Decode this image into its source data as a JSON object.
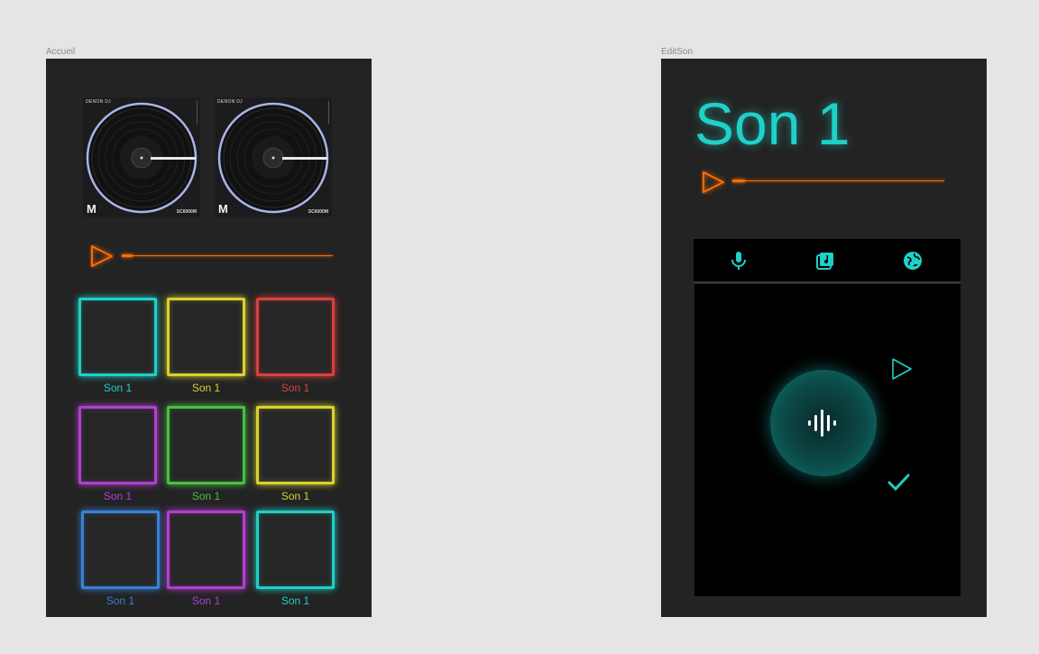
{
  "frames": {
    "accueil": {
      "label": "Accueil",
      "decks": [
        {
          "brand": "DENON DJ",
          "logo": "M",
          "model": "SC6000M"
        },
        {
          "brand": "DENON DJ",
          "logo": "M",
          "model": "SC6000M"
        }
      ],
      "player": {
        "play_icon": "play-triangle-icon",
        "progress": 0.04,
        "accent": "#ff6d00"
      },
      "pads": [
        {
          "label": "Son 1",
          "color": "#1fd0c8"
        },
        {
          "label": "Son 1",
          "color": "#d8d230"
        },
        {
          "label": "Son 1",
          "color": "#d84040"
        },
        {
          "label": "Son 1",
          "color": "#b040d0"
        },
        {
          "label": "Son 1",
          "color": "#48c040"
        },
        {
          "label": "Son 1",
          "color": "#d8d230"
        },
        {
          "label": "Son 1",
          "color": "#3a80d8"
        },
        {
          "label": "Son 1",
          "color": "#b040d0"
        },
        {
          "label": "Son 1",
          "color": "#1fd0c8"
        }
      ]
    },
    "editson": {
      "label": "EditSon",
      "title": "Son 1",
      "player": {
        "play_icon": "play-triangle-icon",
        "progress": 0.04,
        "accent": "#ff6d00"
      },
      "tabs": [
        {
          "name": "microphone-icon"
        },
        {
          "name": "music-library-icon"
        },
        {
          "name": "globe-icon"
        }
      ],
      "accent": "#1fd0c8",
      "record_icon": "waveform-icon",
      "play_icon": "play-outline-icon",
      "confirm_icon": "checkmark-icon"
    }
  }
}
